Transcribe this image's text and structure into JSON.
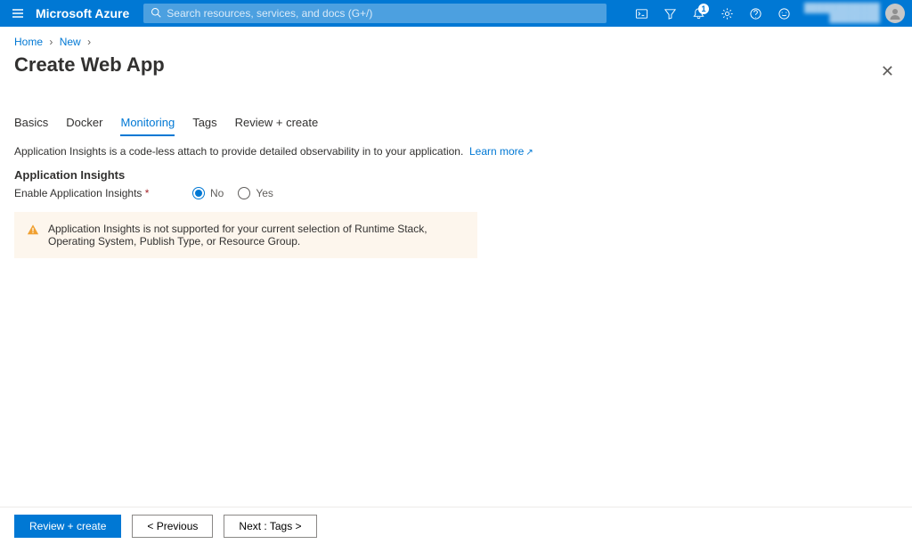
{
  "header": {
    "brand": "Microsoft Azure",
    "search_placeholder": "Search resources, services, and docs (G+/)",
    "badge_count": "1"
  },
  "breadcrumb": {
    "items": [
      "Home",
      "New"
    ]
  },
  "page": {
    "title": "Create Web App"
  },
  "tabs": {
    "items": [
      {
        "label": "Basics"
      },
      {
        "label": "Docker"
      },
      {
        "label": "Monitoring"
      },
      {
        "label": "Tags"
      },
      {
        "label": "Review + create"
      }
    ],
    "active": "Monitoring"
  },
  "intro": {
    "text": "Application Insights is a code-less attach to provide detailed observability in to your application.",
    "learn_more": "Learn more"
  },
  "section": {
    "heading": "Application Insights",
    "field_label": "Enable Application Insights",
    "options": {
      "no": "No",
      "yes": "Yes"
    },
    "selected": "No"
  },
  "warning": {
    "text": "Application Insights is not supported for your current selection of Runtime Stack, Operating System, Publish Type, or Resource Group."
  },
  "footer": {
    "review": "Review + create",
    "previous": "< Previous",
    "next": "Next : Tags >"
  }
}
